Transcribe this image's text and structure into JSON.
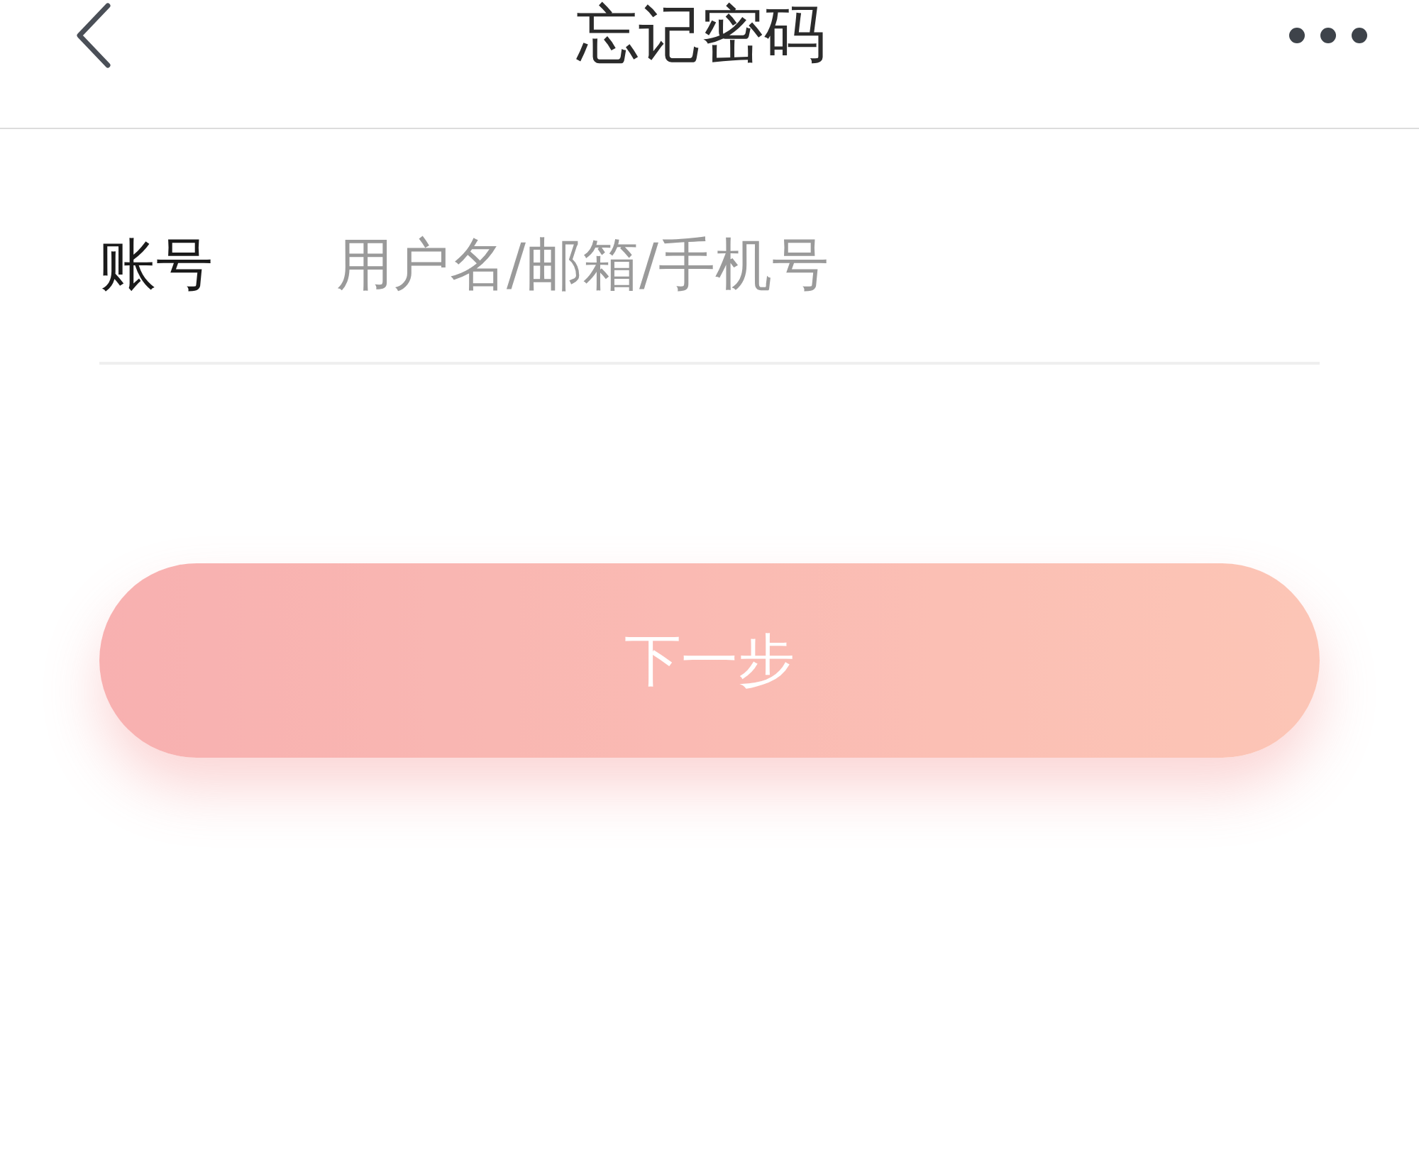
{
  "header": {
    "title": "忘记密码"
  },
  "form": {
    "fields": [
      {
        "label": "账号",
        "placeholder": "用户名/邮箱/手机号"
      }
    ]
  },
  "next_button": {
    "label": "下一步",
    "disabled": true
  }
}
